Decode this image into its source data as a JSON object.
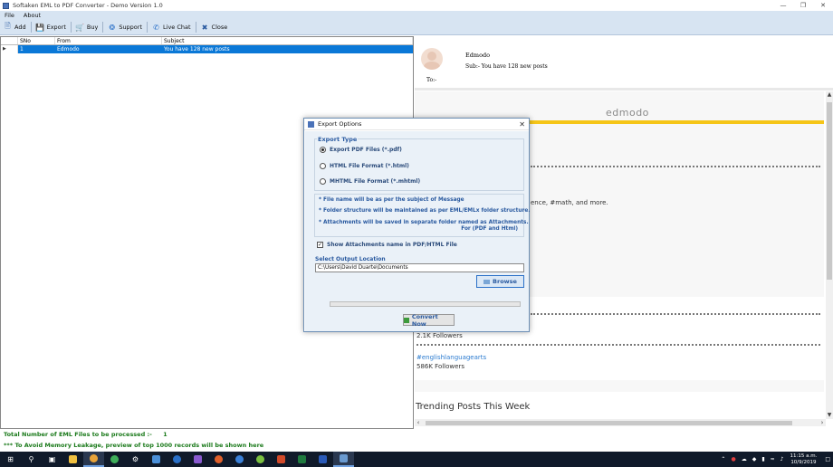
{
  "window": {
    "title": "Softaken EML to PDF Converter - Demo Version 1.0"
  },
  "menu": {
    "file": "File",
    "about": "About"
  },
  "toolbar": {
    "add": "Add",
    "export": "Export",
    "buy": "Buy",
    "support": "Support",
    "live_chat": "Live Chat",
    "close": "Close"
  },
  "grid": {
    "columns": [
      "SNo",
      "From",
      "Subject"
    ],
    "rows": [
      {
        "sno": "1",
        "from": "Edmodo",
        "subject": "You have 128 new posts"
      }
    ]
  },
  "preview": {
    "sender": "Edmodo",
    "subject": "Sub:- You have 128 new posts",
    "to": "To:-",
    "body": {
      "logo": "edmodo",
      "snippet": "ence, #math, and more.",
      "followers_1": "2.1K Followers",
      "hashtag": "#englishlanguagearts",
      "followers_2": "586K Followers",
      "trending": "Trending Posts This Week"
    }
  },
  "status": {
    "total_label": "Total Number of EML Files to be processed :-",
    "total_count": "1",
    "memory_note": "*** To Avoid Memory Leakage, preview of top 1000 records will be shown here"
  },
  "dialog": {
    "title": "Export Options",
    "export_type_label": "Export Type",
    "options": [
      {
        "label": "Export PDF Files (*.pdf)",
        "selected": true
      },
      {
        "label": "HTML File  Format (*.html)",
        "selected": false
      },
      {
        "label": "MHTML File  Format (*.mhtml)",
        "selected": false
      }
    ],
    "notes": [
      "* File name will be as per the subject of Message",
      "* Folder structure will be maintained as per EML/EMLx folder structure.",
      "* Attachments will be saved in separate folder named as Attachments.",
      "For (PDF and Html)"
    ],
    "show_attachments_label": "Show Attachments name in PDF/HTML File",
    "show_attachments_checked": true,
    "output_label": "Select Output Location",
    "output_path": "C:\\Users\\David Duarte\\Documents",
    "browse": "Browse",
    "progress": 0,
    "convert": "Convert Now"
  },
  "taskbar": {
    "time": "11:15 a.m.",
    "date": "10/9/2019"
  },
  "colors": {
    "selection": "#0a78d7",
    "status_green": "#1b7a1b",
    "dialog_text": "#2a5aa0",
    "edmodo_yellow": "#f5c518",
    "toolbar_bg": "#d7e4f2"
  }
}
